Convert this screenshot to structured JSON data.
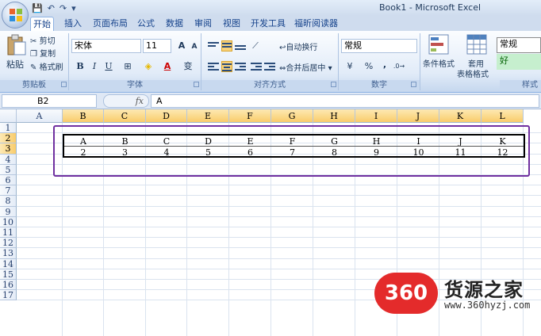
{
  "window": {
    "title": "Book1 - Microsoft Excel"
  },
  "qat": {
    "save_icon": "💾",
    "undo_icon": "↶",
    "redo_icon": "↷",
    "menu_icon": "▾"
  },
  "tabs": [
    "开始",
    "插入",
    "页面布局",
    "公式",
    "数据",
    "审阅",
    "视图",
    "开发工具",
    "福昕阅读器"
  ],
  "ribbon": {
    "clipboard": {
      "paste": "粘贴",
      "cut": "剪切",
      "copy": "复制",
      "format_painter": "格式刷",
      "label": "剪贴板"
    },
    "font": {
      "name": "宋体",
      "size": "11",
      "grow": "A",
      "shrink": "A",
      "bold": "B",
      "italic": "I",
      "underline": "U",
      "wen": "变",
      "label": "字体"
    },
    "alignment": {
      "wrap": "自动换行",
      "merge": "合并后居中",
      "label": "对齐方式"
    },
    "number": {
      "format": "常规",
      "percent": "%",
      "comma": ",",
      "label": "数字"
    },
    "styles": {
      "cond_format": "条件格式",
      "table_format": "套用",
      "table_format2": "表格格式",
      "style_normal": "常规",
      "style_good": "好",
      "label": "样式"
    }
  },
  "formula_bar": {
    "name_box": "B2",
    "fx": "fx",
    "value": "A"
  },
  "columns": [
    "A",
    "B",
    "C",
    "D",
    "E",
    "F",
    "G",
    "H",
    "I",
    "J",
    "K",
    "L"
  ],
  "rows": [
    "1",
    "2",
    "3",
    "4",
    "5",
    "6",
    "7",
    "8",
    "9",
    "10",
    "11",
    "12",
    "13",
    "14",
    "15",
    "16",
    "17"
  ],
  "cells": {
    "row2": [
      "A",
      "B",
      "C",
      "D",
      "E",
      "F",
      "G",
      "H",
      "I",
      "J",
      "K"
    ],
    "row3": [
      "2",
      "3",
      "4",
      "5",
      "6",
      "7",
      "8",
      "9",
      "10",
      "11",
      "12"
    ]
  },
  "watermark": {
    "logo": "360",
    "name": "货源之家",
    "url": "www.360hyzj.com"
  }
}
